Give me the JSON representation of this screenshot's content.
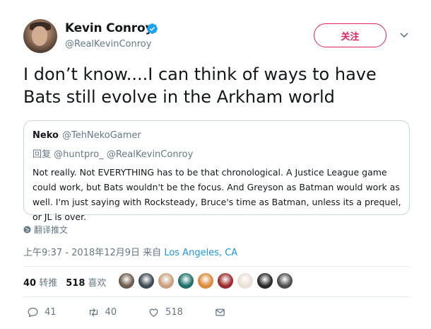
{
  "author": {
    "name": "Kevin Conroy",
    "handle": "@RealKevinConroy",
    "follow_label": "关注"
  },
  "tweet": {
    "text": "I don’t know....I can think of ways to have Bats still evolve in the Arkham world"
  },
  "quoted": {
    "name": "Neko",
    "handle": "@TehNekoGamer",
    "reply_to": "回复 @huntpro_ @RealKevinConroy",
    "text": "Not really. Not EVERYTHING has to be that chronological. A Justice League game could work, but Bats wouldn't be the focus. And Greyson as Batman would work as well. I'm just saying with Rocksteady, Bruce's time as Batman, unless its a prequel, or JL is over."
  },
  "translate_label": "翻译推文",
  "timestamp": {
    "time_date": "上午9:37 - 2018年12月9日 来自 ",
    "location": "Los Angeles, CA"
  },
  "stats": {
    "retweets_count": "40",
    "retweets_label": "转推",
    "likes_count": "518",
    "likes_label": "喜欢"
  },
  "liker_avatars": [
    "#6b5a4d",
    "#3d4a52",
    "#c9a07e",
    "#1f6f6a",
    "#d98b3a",
    "#9c2b2b",
    "#e8e0d5",
    "#2a2a2a",
    "#4d4d4d"
  ],
  "actions": {
    "reply_count": "41",
    "retweet_count": "40",
    "like_count": "518"
  },
  "colors": {
    "accent": "#1b95e0",
    "follow": "#e0245e",
    "secondary_text": "#657786"
  }
}
